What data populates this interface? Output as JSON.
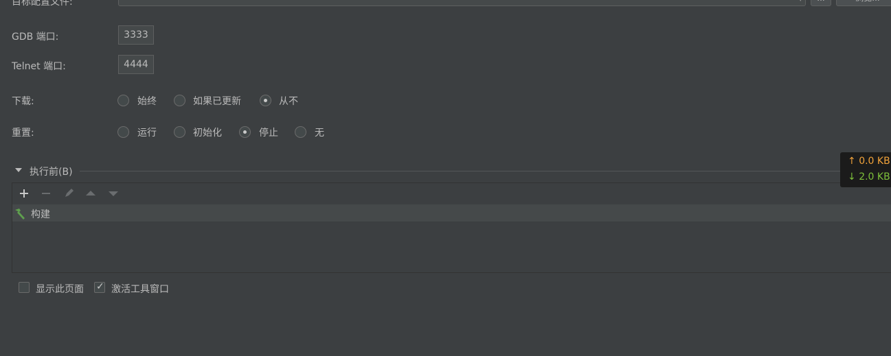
{
  "config_row": {
    "label": "目标配置文件:",
    "button1": "...",
    "button2": "浏览..."
  },
  "gdb_port": {
    "label": "GDB 端口:",
    "value": "3333"
  },
  "telnet_port": {
    "label": "Telnet 端口:",
    "value": "4444"
  },
  "download": {
    "label": "下载:",
    "options": [
      "始终",
      "如果已更新",
      "从不"
    ],
    "selected": "从不"
  },
  "reset": {
    "label": "重置:",
    "options": [
      "运行",
      "初始化",
      "停止",
      "无"
    ],
    "selected": "停止"
  },
  "before_launch": {
    "title": "执行前(B)",
    "toolbar": [
      "plus-icon",
      "minus-icon",
      "edit-icon",
      "move-up-icon",
      "move-down-icon"
    ],
    "items": [
      {
        "label": "构建",
        "icon": "hammer-icon"
      }
    ]
  },
  "checkboxes": {
    "show_page": {
      "label": "显示此页面",
      "checked": false
    },
    "activate_tool_window": {
      "label": "激活工具窗口",
      "checked": true
    }
  },
  "network_speed": {
    "up": "0.0 KB",
    "down": "2.0 KB",
    "up_color": "#f2a33a",
    "down_color": "#7ec13a"
  }
}
